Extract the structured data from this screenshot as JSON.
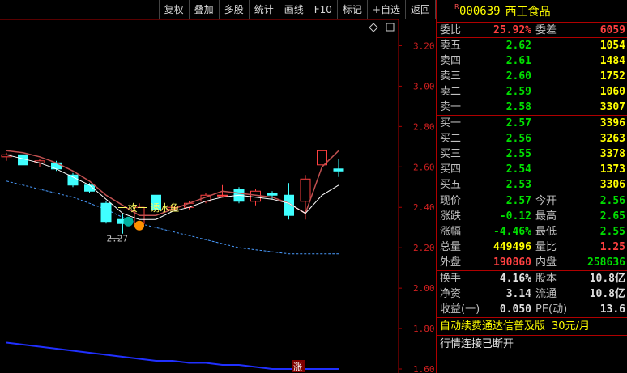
{
  "toolbar": [
    "复权",
    "叠加",
    "多股",
    "统计",
    "画线",
    "F10",
    "标记",
    "+自选",
    "返回"
  ],
  "stock": {
    "tag": "R",
    "code": "000639",
    "name": "西王食品"
  },
  "summary": {
    "wb_label": "委比",
    "wb_value": "25.92%",
    "wc_label": "委差",
    "wc_value": "6059"
  },
  "asks": [
    {
      "label": "卖五",
      "price": "2.62",
      "vol": "1054"
    },
    {
      "label": "卖四",
      "price": "2.61",
      "vol": "1484"
    },
    {
      "label": "卖三",
      "price": "2.60",
      "vol": "1752"
    },
    {
      "label": "卖二",
      "price": "2.59",
      "vol": "1060"
    },
    {
      "label": "卖一",
      "price": "2.58",
      "vol": "3307"
    }
  ],
  "bids": [
    {
      "label": "买一",
      "price": "2.57",
      "vol": "3396"
    },
    {
      "label": "买二",
      "price": "2.56",
      "vol": "3263"
    },
    {
      "label": "买三",
      "price": "2.55",
      "vol": "3378"
    },
    {
      "label": "买四",
      "price": "2.54",
      "vol": "1373"
    },
    {
      "label": "买五",
      "price": "2.53",
      "vol": "3306"
    }
  ],
  "quote": {
    "xj_l": "现价",
    "xj_v": "2.57",
    "jk_l": "今开",
    "jk_v": "2.56",
    "zd_l": "涨跌",
    "zd_v": "-0.12",
    "zg_l": "最高",
    "zg_v": "2.65",
    "zf_l": "涨幅",
    "zf_v": "-4.46%",
    "zdi_l": "最低",
    "zdi_v": "2.55",
    "zl_l": "总量",
    "zl_v": "449496",
    "lb_l": "量比",
    "lb_v": "1.25",
    "wp_l": "外盘",
    "wp_v": "190860",
    "np_l": "内盘",
    "np_v": "258636"
  },
  "fund": {
    "hs_l": "换手",
    "hs_v": "4.16%",
    "gb_l": "股本",
    "gb_v": "10.8亿",
    "jz_l": "净资",
    "jz_v": "3.14",
    "lt_l": "流通",
    "lt_v": "10.8亿",
    "sy_l": "收益(一)",
    "sy_v": "0.050",
    "pe_l": "PE(动)",
    "pe_v": "13.6"
  },
  "promo": {
    "text": "自动续费通达信普及版",
    "price": "30元/月"
  },
  "status": "行情连接已断开",
  "chart": {
    "yticks": [
      "3.20",
      "3.00",
      "2.80",
      "2.60",
      "2.40",
      "2.20",
      "2.00",
      "1.80",
      "1.60"
    ],
    "low_marker": "2.27",
    "annotation": "一枚一 诱水鱼",
    "bottom_tag": "涨"
  },
  "chart_data": {
    "type": "candlestick",
    "yticks": [
      3.2,
      3.0,
      2.8,
      2.6,
      2.4,
      2.2,
      2.0,
      1.8,
      1.6
    ],
    "ylim": [
      1.58,
      3.33
    ],
    "candles": [
      {
        "o": 2.65,
        "h": 2.67,
        "l": 2.63,
        "c": 2.66
      },
      {
        "o": 2.66,
        "h": 2.68,
        "l": 2.6,
        "c": 2.61
      },
      {
        "o": 2.62,
        "h": 2.64,
        "l": 2.6,
        "c": 2.63
      },
      {
        "o": 2.62,
        "h": 2.63,
        "l": 2.58,
        "c": 2.59
      },
      {
        "o": 2.56,
        "h": 2.57,
        "l": 2.5,
        "c": 2.51
      },
      {
        "o": 2.51,
        "h": 2.52,
        "l": 2.47,
        "c": 2.48
      },
      {
        "o": 2.42,
        "h": 2.43,
        "l": 2.32,
        "c": 2.33
      },
      {
        "o": 2.34,
        "h": 2.37,
        "l": 2.27,
        "c": 2.32
      },
      {
        "o": 2.32,
        "h": 2.42,
        "l": 2.3,
        "c": 2.4
      },
      {
        "o": 2.46,
        "h": 2.47,
        "l": 2.38,
        "c": 2.39
      },
      {
        "o": 2.39,
        "h": 2.41,
        "l": 2.38,
        "c": 2.4
      },
      {
        "o": 2.4,
        "h": 2.43,
        "l": 2.39,
        "c": 2.42
      },
      {
        "o": 2.43,
        "h": 2.47,
        "l": 2.42,
        "c": 2.46
      },
      {
        "o": 2.46,
        "h": 2.51,
        "l": 2.45,
        "c": 2.46
      },
      {
        "o": 2.49,
        "h": 2.5,
        "l": 2.42,
        "c": 2.43
      },
      {
        "o": 2.43,
        "h": 2.49,
        "l": 2.41,
        "c": 2.48
      },
      {
        "o": 2.47,
        "h": 2.48,
        "l": 2.44,
        "c": 2.46
      },
      {
        "o": 2.46,
        "h": 2.52,
        "l": 2.34,
        "c": 2.36
      },
      {
        "o": 2.43,
        "h": 2.56,
        "l": 2.34,
        "c": 2.54
      },
      {
        "o": 2.61,
        "h": 2.85,
        "l": 2.55,
        "c": 2.68
      },
      {
        "o": 2.59,
        "h": 2.64,
        "l": 2.55,
        "c": 2.58
      }
    ],
    "ma_white": [
      2.66,
      2.64,
      2.62,
      2.59,
      2.55,
      2.51,
      2.44,
      2.37,
      2.34,
      2.34,
      2.38,
      2.4,
      2.43,
      2.45,
      2.46,
      2.45,
      2.44,
      2.42,
      2.37,
      2.46,
      2.51
    ],
    "ma_brown": [
      2.68,
      2.67,
      2.65,
      2.62,
      2.58,
      2.53,
      2.46,
      2.41,
      2.36,
      2.36,
      2.39,
      2.42,
      2.45,
      2.48,
      2.47,
      2.46,
      2.45,
      2.42,
      2.37,
      2.6,
      2.68
    ],
    "ma_dashed": [
      2.53,
      2.51,
      2.49,
      2.47,
      2.45,
      2.42,
      2.39,
      2.35,
      2.32,
      2.3,
      2.28,
      2.26,
      2.24,
      2.22,
      2.2,
      2.19,
      2.18,
      2.17,
      2.17,
      2.17,
      2.17
    ],
    "ma_blue": [
      1.73,
      1.72,
      1.71,
      1.7,
      1.69,
      1.68,
      1.67,
      1.66,
      1.65,
      1.64,
      1.64,
      1.63,
      1.63,
      1.62,
      1.62,
      1.61,
      1.6,
      1.6,
      1.6,
      1.6,
      1.6
    ]
  }
}
